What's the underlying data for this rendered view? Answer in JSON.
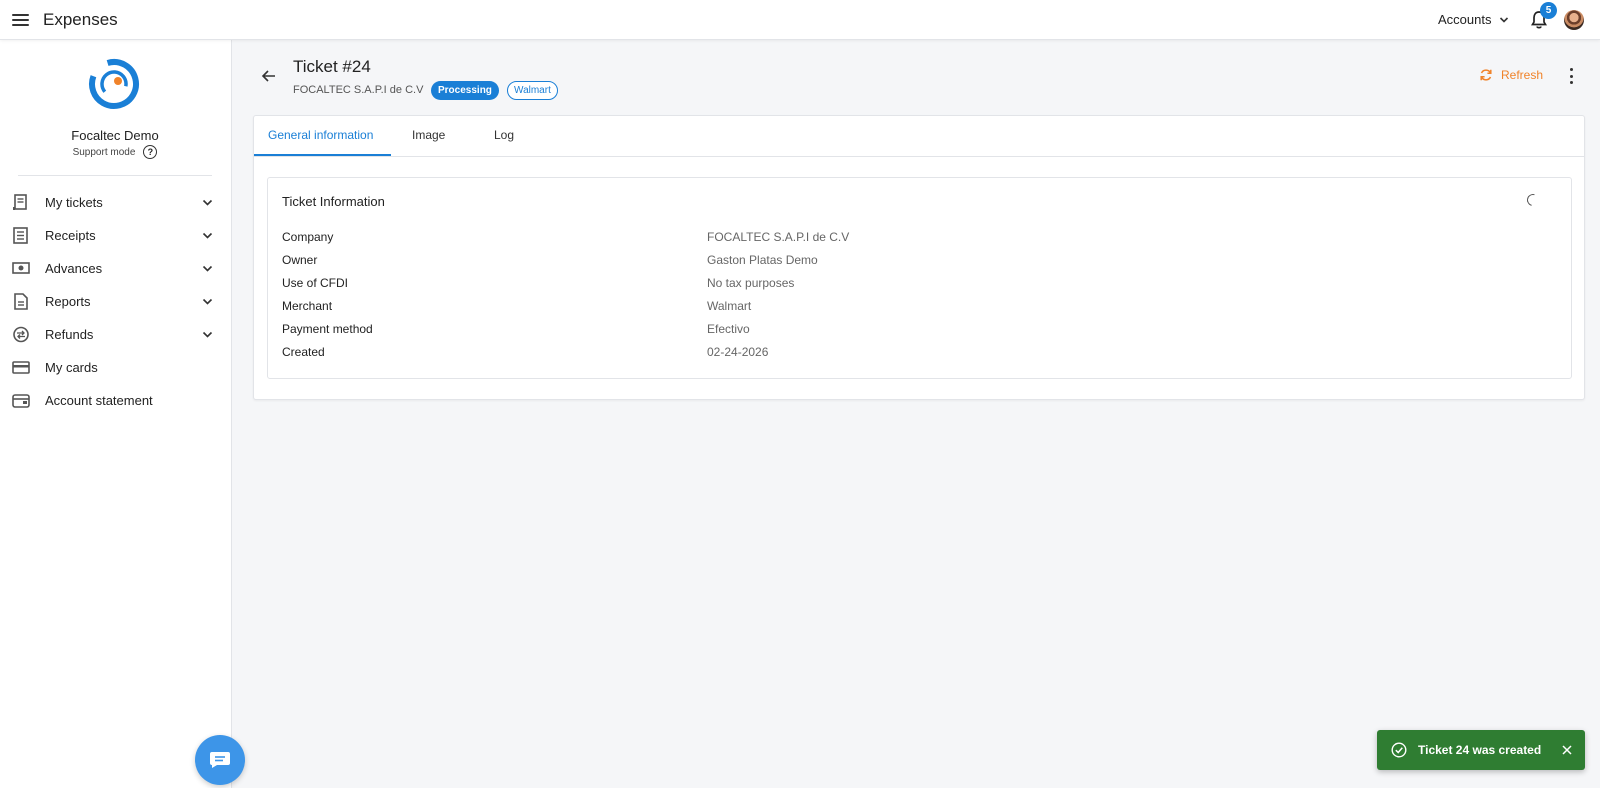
{
  "app": {
    "title": "Expenses"
  },
  "topbar": {
    "accounts_label": "Accounts",
    "notification_count": "5"
  },
  "sidebar": {
    "org_name": "Focaltec Demo",
    "support_mode": "Support mode",
    "help_glyph": "?",
    "items": [
      {
        "label": "My tickets",
        "icon": "ticket-icon",
        "expandable": true
      },
      {
        "label": "Receipts",
        "icon": "receipt-icon",
        "expandable": true
      },
      {
        "label": "Advances",
        "icon": "cash-icon",
        "expandable": true
      },
      {
        "label": "Reports",
        "icon": "report-icon",
        "expandable": true
      },
      {
        "label": "Refunds",
        "icon": "refund-icon",
        "expandable": true
      },
      {
        "label": "My cards",
        "icon": "card-icon",
        "expandable": false
      },
      {
        "label": "Account statement",
        "icon": "wallet-icon",
        "expandable": false
      }
    ]
  },
  "header": {
    "title": "Ticket #24",
    "company": "FOCALTEC S.A.P.I de C.V",
    "status_badge": "Processing",
    "merchant_badge": "Walmart",
    "refresh_label": "Refresh"
  },
  "tabs": [
    {
      "label": "General information",
      "active": true
    },
    {
      "label": "Image",
      "active": false
    },
    {
      "label": "Log",
      "active": false
    }
  ],
  "ticket_info": {
    "title": "Ticket Information",
    "rows": [
      {
        "label": "Company",
        "value": "FOCALTEC S.A.P.I de C.V"
      },
      {
        "label": "Owner",
        "value": "Gaston Platas Demo"
      },
      {
        "label": "Use of CFDI",
        "value": "No tax purposes"
      },
      {
        "label": "Merchant",
        "value": "Walmart"
      },
      {
        "label": "Payment method",
        "value": "Efectivo"
      },
      {
        "label": "Created",
        "value": "02-24-2026"
      }
    ]
  },
  "toast": {
    "message": "Ticket 24 was created"
  },
  "colors": {
    "accent": "#1a7fd6",
    "refresh": "#f0832a",
    "toast_bg": "#2f7d32",
    "chat_fab": "#3d95e8"
  }
}
